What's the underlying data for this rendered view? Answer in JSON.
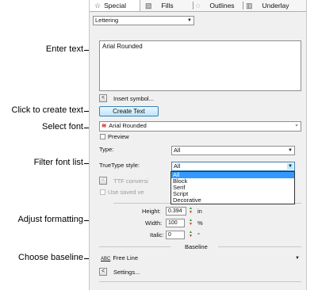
{
  "callouts": {
    "enter_text": "Enter text",
    "create_text": "Click to create text",
    "select_font": "Select font",
    "filter_font": "Filter font list",
    "adjust_formatting": "Adjust formatting",
    "choose_baseline": "Choose baseline"
  },
  "tabs": {
    "special": "Special",
    "fills": "Fills",
    "outlines": "Outlines",
    "underlay": "Underlay"
  },
  "icons": {
    "special": "star-icon",
    "fills": "fill-icon",
    "outlines": "outline-icon",
    "underlay": "underlay-icon"
  },
  "object_type": "Lettering",
  "text_value": "Arial Rounded",
  "insert_symbol_label": "Insert symbol...",
  "create_text_label": "Create Text",
  "font": {
    "selected": "Arial Rounded",
    "preview_label": "Preview"
  },
  "type": {
    "label": "Type:",
    "value": "All"
  },
  "truetype": {
    "label": "TrueType style:",
    "value": "All",
    "options": [
      "All",
      "Block",
      "Serif",
      "Script",
      "Decorative"
    ],
    "selected_index": 0
  },
  "ttf_label": "TTF conversi",
  "use_saved_label": "Use saved ve",
  "formatting": {
    "height_label": "Height:",
    "height_value": "0.394",
    "height_unit": "in",
    "width_label": "Width:",
    "width_value": "100",
    "width_unit": "%",
    "italic_label": "Italic:",
    "italic_value": "0",
    "italic_unit": "°"
  },
  "baseline": {
    "section_label": "Baseline",
    "value": "Free Line",
    "icon_text": "ABC",
    "settings_label": "Settings..."
  },
  "colors": {
    "accent": "#3399ff",
    "button_border": "#3c7fb1",
    "font_icon": "#cc2222"
  }
}
